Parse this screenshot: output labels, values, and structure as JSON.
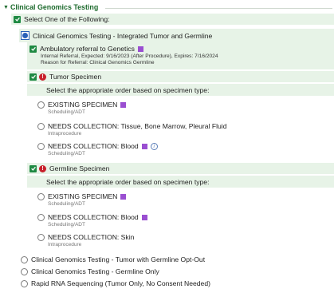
{
  "section": {
    "title": "Clinical Genomics Testing"
  },
  "select_one": "Select One of the Following:",
  "selected_option": "Clinical Genomics Testing - Integrated Tumor and Germline",
  "referral": {
    "title": "Ambulatory referral to Genetics",
    "line1": "Internal Referral, Expected: 9/16/2023 (After Procedure), Expires: 7/16/2024",
    "line2": "Reason for Referral: Clinical Genomics Germline"
  },
  "tumor": {
    "title": "Tumor Specimen",
    "instruction": "Select the appropriate order based on specimen type:",
    "options": [
      {
        "label": "EXISTING SPECIMEN",
        "sub": "Scheduling/ADT"
      },
      {
        "label": "NEEDS COLLECTION: Tissue, Bone Marrow, Pleural Fluid",
        "sub": "Intraprocedure"
      },
      {
        "label": "NEEDS COLLECTION: Blood",
        "sub": "Scheduling/ADT"
      }
    ]
  },
  "germline": {
    "title": "Germline Specimen",
    "instruction": "Select the appropriate order based on specimen type:",
    "options": [
      {
        "label": "EXISTING SPECIMEN",
        "sub": "Scheduling/ADT"
      },
      {
        "label": "NEEDS COLLECTION: Blood",
        "sub": "Scheduling/ADT"
      },
      {
        "label": "NEEDS COLLECTION: Skin",
        "sub": "Intraprocedure"
      }
    ]
  },
  "other_options": [
    "Clinical Genomics Testing - Tumor with Germline Opt-Out",
    "Clinical Genomics Testing - Germline Only",
    "Rapid RNA Sequencing (Tumor Only, No Consent Needed)"
  ],
  "colors": {
    "check": "#1f8a43",
    "band": "#e7f3e7",
    "accent": "#9a4fd1",
    "warning": "#c8202b",
    "radio_selected": "#2a62b8"
  },
  "icons": {
    "collapse": "caret-down-icon",
    "warning": "warning-icon",
    "info": "info-icon",
    "order_marker": "purple-square-icon"
  }
}
